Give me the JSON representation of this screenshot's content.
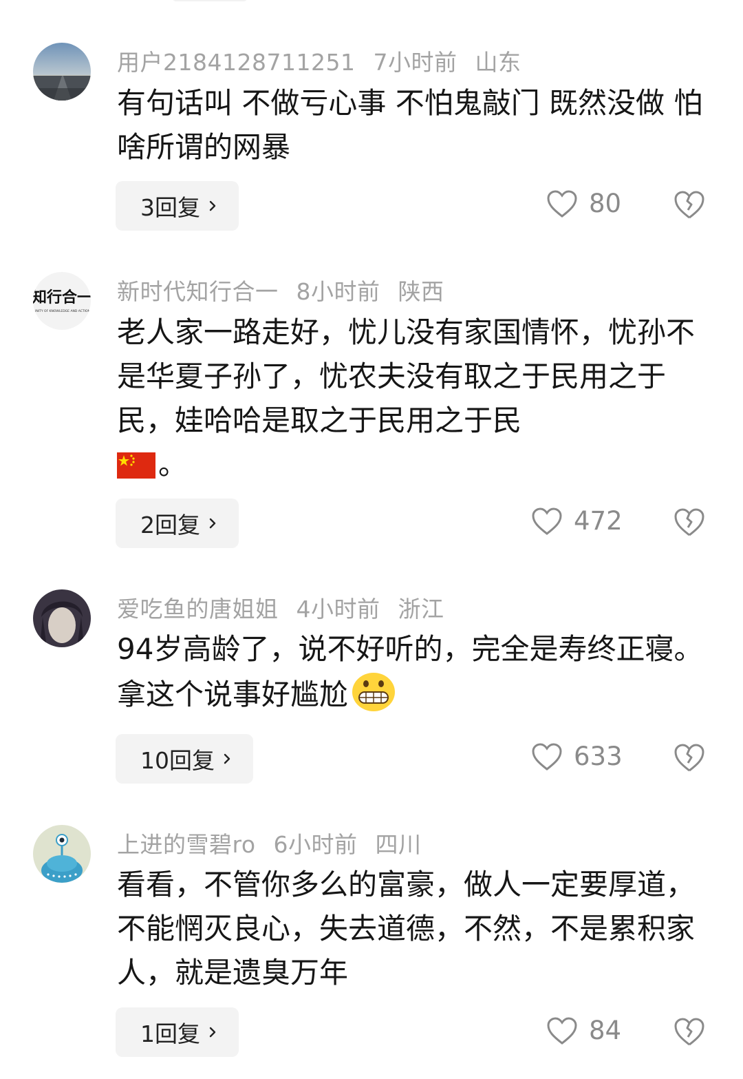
{
  "comments": [
    {
      "username": "用户2184128711251",
      "time": "7小时前",
      "location": "山东",
      "text": "有句话叫 不做亏心事 不怕鬼敲门 既然没做 怕啥所谓的网暴",
      "reply_label": "3回复",
      "likes": "80",
      "avatar": "road-avatar"
    },
    {
      "username": "新时代知行合一",
      "time": "8小时前",
      "location": "陕西",
      "text": "老人家一路走好，忧儿没有家国情怀，忧孙不是华夏子孙了，忧农夫没有取之于民用之于民，娃哈哈是取之于民用之于民",
      "text_suffix": "。",
      "inline_icon": "china-flag-emoji",
      "reply_label": "2回复",
      "likes": "472",
      "avatar": "calligraphy-avatar",
      "avatar_text_1": "知行合一",
      "avatar_text_2": "UNITY OF KNOWLEDGE AND ACTION"
    },
    {
      "username": "爱吃鱼的唐姐姐",
      "time": "4小时前",
      "location": "浙江",
      "text": "94岁高龄了，说不好听的，完全是寿终正寝。拿这个说事好尴尬",
      "inline_icon": "grimacing-face-emoji",
      "reply_label": "10回复",
      "likes": "633",
      "avatar": "portrait-avatar"
    },
    {
      "username": "上进的雪碧ro",
      "time": "6小时前",
      "location": "四川",
      "text": "看看，不管你多么的富豪，做人一定要厚道，不能惘灭良心，失去道德，不然，不是累积家人，就是遗臭万年",
      "reply_label": "1回复",
      "likes": "84",
      "avatar": "blue-alien-avatar"
    }
  ],
  "icons": {
    "like": "heart-outline-icon",
    "dislike": "broken-heart-icon",
    "reply_chevron": "chevron-right-icon"
  },
  "colors": {
    "meta_text": "#a3a3a3",
    "body_text": "#161616",
    "reply_bg": "#f3f3f3",
    "icon_gray": "#8a8a8a"
  }
}
